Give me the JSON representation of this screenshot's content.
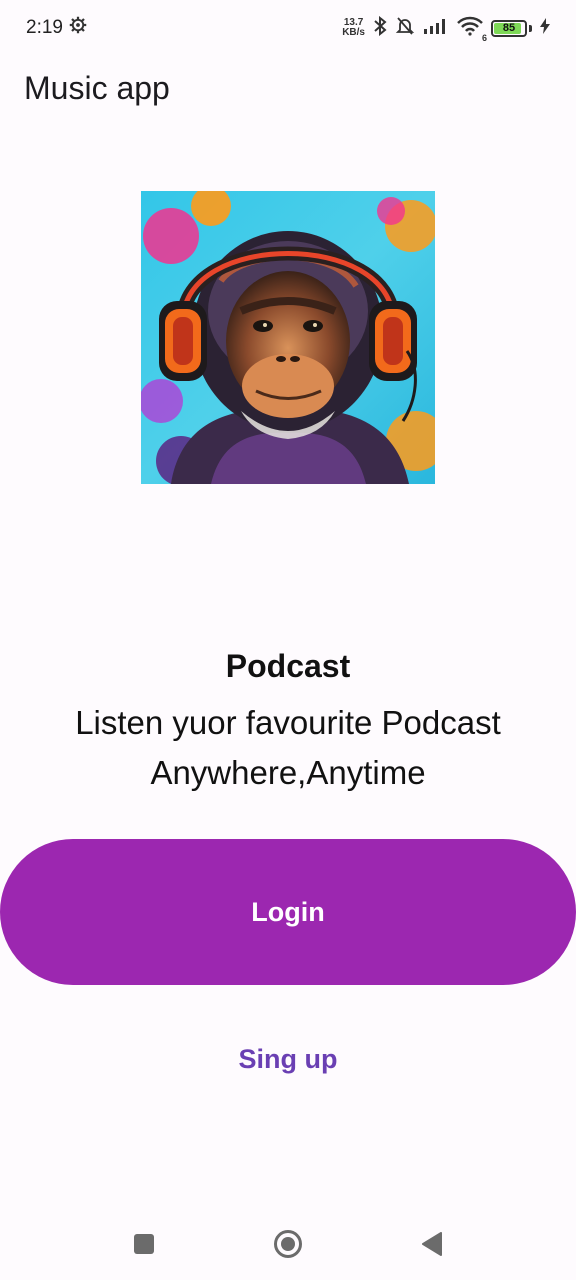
{
  "status_bar": {
    "time": "2:19",
    "net_speed_value": "13.7",
    "net_speed_unit": "KB/s",
    "wifi_label": "6",
    "battery_level": "85",
    "icons": [
      "settings-gear-icon",
      "bluetooth-icon",
      "mute-bell-icon",
      "signal-icon",
      "wifi-icon",
      "battery-icon",
      "charging-icon"
    ]
  },
  "app": {
    "title": "Music app"
  },
  "hero": {
    "image_alt": "chimpanzee-with-headphones-artwork"
  },
  "onboarding": {
    "headline": "Podcast",
    "tagline": "Listen yuor favourite Podcast Anywhere,Anytime"
  },
  "actions": {
    "login_label": "Login",
    "signup_label": "Sing up"
  },
  "colors": {
    "primary": "#9c27b0",
    "link": "#6a3fb3",
    "background": "#fefbfe"
  },
  "nav_bar": {
    "buttons": [
      "recents-square-icon",
      "home-circle-icon",
      "back-triangle-icon"
    ]
  }
}
